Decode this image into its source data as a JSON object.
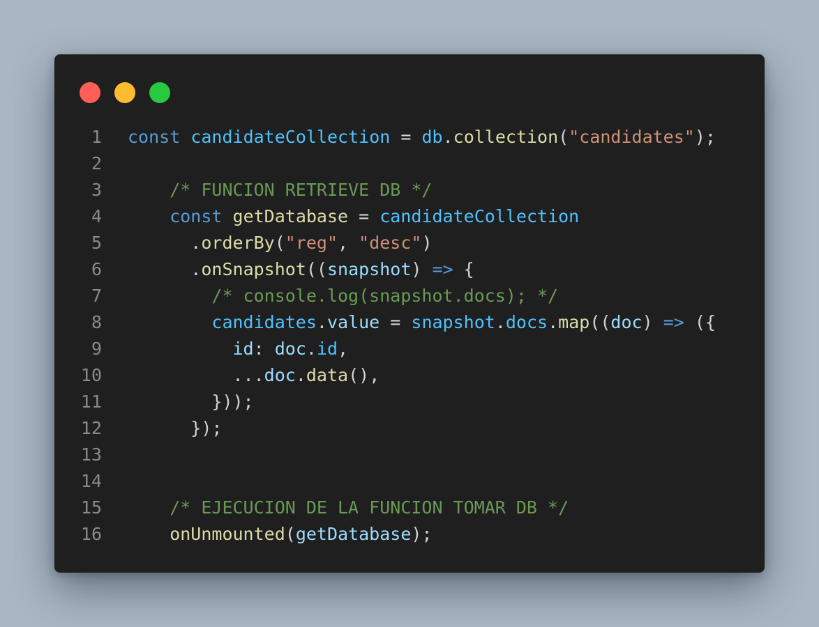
{
  "background_color": "#a9b6c4",
  "editor_background": "#1f1f1f",
  "window_controls": [
    {
      "name": "close",
      "color": "#ff5f57"
    },
    {
      "name": "minimize",
      "color": "#febc2e"
    },
    {
      "name": "maximize",
      "color": "#28c840"
    }
  ],
  "colors": {
    "keyword": "#569cd6",
    "constant": "#4fc1ff",
    "variable": "#9cdcfe",
    "function": "#dcdcaa",
    "string": "#ce9178",
    "comment": "#6a9955",
    "plain": "#d4d4d4",
    "line_number": "#8a8a8a"
  },
  "lines": [
    {
      "number": "1",
      "indent": 0,
      "tokens": [
        {
          "t": "kw",
          "v": "const"
        },
        {
          "t": "pn",
          "v": " "
        },
        {
          "t": "const",
          "v": "candidateCollection"
        },
        {
          "t": "pn",
          "v": " = "
        },
        {
          "t": "const",
          "v": "db"
        },
        {
          "t": "pn",
          "v": "."
        },
        {
          "t": "fn",
          "v": "collection"
        },
        {
          "t": "pn",
          "v": "("
        },
        {
          "t": "str",
          "v": "\"candidates\""
        },
        {
          "t": "pn",
          "v": ");"
        }
      ]
    },
    {
      "number": "2",
      "indent": 0,
      "tokens": []
    },
    {
      "number": "3",
      "indent": 4,
      "tokens": [
        {
          "t": "cm",
          "v": "/* FUNCION RETRIEVE DB */"
        }
      ]
    },
    {
      "number": "4",
      "indent": 4,
      "tokens": [
        {
          "t": "kw",
          "v": "const"
        },
        {
          "t": "pn",
          "v": " "
        },
        {
          "t": "fn",
          "v": "getDatabase"
        },
        {
          "t": "pn",
          "v": " = "
        },
        {
          "t": "const",
          "v": "candidateCollection"
        }
      ]
    },
    {
      "number": "5",
      "indent": 6,
      "tokens": [
        {
          "t": "pn",
          "v": "."
        },
        {
          "t": "fn",
          "v": "orderBy"
        },
        {
          "t": "pn",
          "v": "("
        },
        {
          "t": "str",
          "v": "\"reg\""
        },
        {
          "t": "pn",
          "v": ", "
        },
        {
          "t": "str",
          "v": "\"desc\""
        },
        {
          "t": "pn",
          "v": ")"
        }
      ]
    },
    {
      "number": "6",
      "indent": 6,
      "tokens": [
        {
          "t": "pn",
          "v": "."
        },
        {
          "t": "fn",
          "v": "onSnapshot"
        },
        {
          "t": "pn",
          "v": "(("
        },
        {
          "t": "var",
          "v": "snapshot"
        },
        {
          "t": "pn",
          "v": ") "
        },
        {
          "t": "kw",
          "v": "=>"
        },
        {
          "t": "pn",
          "v": " {"
        }
      ]
    },
    {
      "number": "7",
      "indent": 8,
      "tokens": [
        {
          "t": "cm",
          "v": "/* console.log(snapshot.docs); */"
        }
      ]
    },
    {
      "number": "8",
      "indent": 8,
      "tokens": [
        {
          "t": "const",
          "v": "candidates"
        },
        {
          "t": "pn",
          "v": "."
        },
        {
          "t": "var",
          "v": "value"
        },
        {
          "t": "pn",
          "v": " = "
        },
        {
          "t": "const",
          "v": "snapshot"
        },
        {
          "t": "pn",
          "v": "."
        },
        {
          "t": "const",
          "v": "docs"
        },
        {
          "t": "pn",
          "v": "."
        },
        {
          "t": "fn",
          "v": "map"
        },
        {
          "t": "pn",
          "v": "(("
        },
        {
          "t": "var",
          "v": "doc"
        },
        {
          "t": "pn",
          "v": ") "
        },
        {
          "t": "kw",
          "v": "=>"
        },
        {
          "t": "pn",
          "v": " ({"
        }
      ]
    },
    {
      "number": "9",
      "indent": 10,
      "tokens": [
        {
          "t": "var",
          "v": "id"
        },
        {
          "t": "pn",
          "v": ": "
        },
        {
          "t": "var",
          "v": "doc"
        },
        {
          "t": "pn",
          "v": "."
        },
        {
          "t": "const",
          "v": "id"
        },
        {
          "t": "pn",
          "v": ","
        }
      ]
    },
    {
      "number": "10",
      "indent": 10,
      "tokens": [
        {
          "t": "pn",
          "v": "..."
        },
        {
          "t": "var",
          "v": "doc"
        },
        {
          "t": "pn",
          "v": "."
        },
        {
          "t": "fn",
          "v": "data"
        },
        {
          "t": "pn",
          "v": "(),"
        }
      ]
    },
    {
      "number": "11",
      "indent": 8,
      "tokens": [
        {
          "t": "pn",
          "v": "}));"
        }
      ]
    },
    {
      "number": "12",
      "indent": 6,
      "tokens": [
        {
          "t": "pn",
          "v": "});"
        }
      ]
    },
    {
      "number": "13",
      "indent": 0,
      "tokens": []
    },
    {
      "number": "14",
      "indent": 0,
      "tokens": []
    },
    {
      "number": "15",
      "indent": 4,
      "tokens": [
        {
          "t": "cm",
          "v": "/* EJECUCION DE LA FUNCION TOMAR DB */"
        }
      ]
    },
    {
      "number": "16",
      "indent": 4,
      "tokens": [
        {
          "t": "fn",
          "v": "onUnmounted"
        },
        {
          "t": "pn",
          "v": "("
        },
        {
          "t": "var",
          "v": "getDatabase"
        },
        {
          "t": "pn",
          "v": ");"
        }
      ]
    }
  ]
}
